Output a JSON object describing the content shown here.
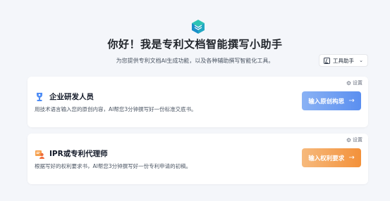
{
  "header": {
    "title": "你好！我是专利文档智能撰写小助手",
    "subtitle": "为您提供专利文档AI生成功能，以及各种辅助撰写智能化工具。",
    "tools_button": "工具助手"
  },
  "cards": [
    {
      "title": "企业研发人员",
      "description": "用技术语言输入您的原创内容，AI帮您3分钟撰写好一份标准交底书。",
      "settings_label": "设置",
      "action_label": "输入原创构思",
      "accent": "#5b8ff0"
    },
    {
      "title": "IPR或专利代理师",
      "description": "根据写好的权利要求书，AI帮您3分钟撰写好一份专利申请的初稿。",
      "settings_label": "设置",
      "action_label": "输入权利要求",
      "accent": "#f3913a"
    }
  ],
  "icons": {
    "logo": "cube-logo-icon",
    "tools": "edit-square-icon",
    "chevron": "chevron-down-icon",
    "settings": "gear-icon",
    "role1": "trophy-person-icon",
    "role2": "agent-person-icon",
    "arrow": "arrow-right-icon"
  }
}
